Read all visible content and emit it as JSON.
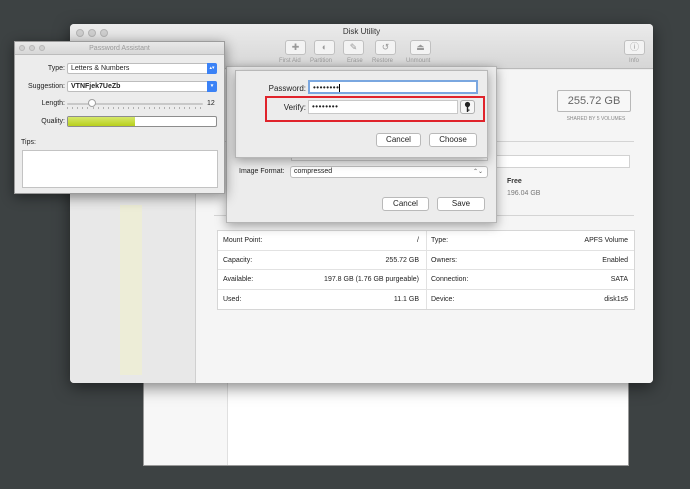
{
  "window": {
    "title": "Disk Utility",
    "toolbar": [
      {
        "label": "First Aid",
        "icon": "first-aid-icon"
      },
      {
        "label": "Partition",
        "icon": "partition-icon"
      },
      {
        "label": "Erase",
        "icon": "erase-icon"
      },
      {
        "label": "Restore",
        "icon": "restore-icon"
      },
      {
        "label": "Unmount",
        "icon": "unmount-icon"
      }
    ],
    "info_label": "Info"
  },
  "volume": {
    "capacity": "255.72 GB",
    "capacity_sub": "SHARED BY 5 VOLUMES",
    "free_label": "Free",
    "free_value": "196.04 GB"
  },
  "info_table": {
    "left": [
      {
        "label": "Mount Point:",
        "value": "/"
      },
      {
        "label": "Capacity:",
        "value": "255.72 GB"
      },
      {
        "label": "Available:",
        "value": "197.8 GB (1.76 GB purgeable)"
      },
      {
        "label": "Used:",
        "value": "11.1 GB"
      }
    ],
    "right": [
      {
        "label": "Type:",
        "value": "APFS Volume"
      },
      {
        "label": "Owners:",
        "value": "Enabled"
      },
      {
        "label": "Connection:",
        "value": "SATA"
      },
      {
        "label": "Device:",
        "value": "disk1s5"
      }
    ]
  },
  "sheet": {
    "image_format_label": "Image Format:",
    "image_format_value": "compressed",
    "cancel_label": "Cancel",
    "save_label": "Save"
  },
  "password_panel": {
    "password_label": "Password:",
    "password_value": "••••••••",
    "verify_label": "Verify:",
    "verify_value": "••••••••",
    "cancel_label": "Cancel",
    "choose_label": "Choose"
  },
  "password_assistant": {
    "title": "Password Assistant",
    "type_label": "Type:",
    "type_value": "Letters & Numbers",
    "suggestion_label": "Suggestion:",
    "suggestion_value": "VTNFjek7UeZb",
    "length_label": "Length:",
    "length_value": "12",
    "length_level": 12,
    "quality_label": "Quality:",
    "quality_level": 0.45,
    "tips_label": "Tips:"
  },
  "colors": {
    "highlight": "#e0232b",
    "accent": "#3b82f6"
  }
}
